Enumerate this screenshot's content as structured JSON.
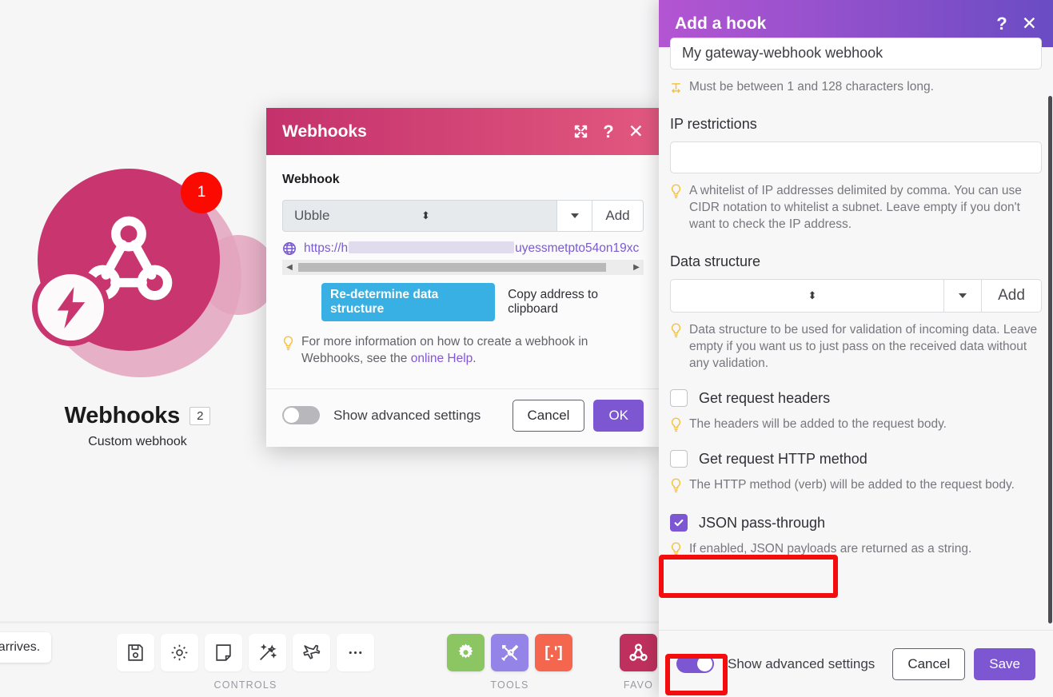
{
  "node": {
    "title": "Webhooks",
    "count_badge": "2",
    "error_badge": "1",
    "subtitle": "Custom webhook"
  },
  "tooltip": {
    "text": "ta arrives."
  },
  "toolbar": {
    "groups": [
      {
        "label": "CONTROLS",
        "items": [
          {
            "name": "save-icon"
          },
          {
            "name": "gear-icon"
          },
          {
            "name": "note-icon"
          },
          {
            "name": "magic-wand-icon"
          },
          {
            "name": "airplane-icon"
          },
          {
            "name": "more-options-icon"
          }
        ]
      },
      {
        "label": "TOOLS",
        "items": [
          {
            "name": "tools-gear-icon",
            "color": "#8cc662"
          },
          {
            "name": "tools-wrench-icon",
            "color": "#9584e8"
          },
          {
            "name": "tools-regex-icon",
            "color": "#f4674e",
            "glyph": "[.']"
          }
        ]
      },
      {
        "label": "FAVO",
        "items": [
          {
            "name": "favorites-webhook-icon",
            "color": "#c0305f"
          }
        ]
      }
    ]
  },
  "webhooks_dialog": {
    "title": "Webhooks",
    "help_icon": "question-mark-icon",
    "close_icon": "close-icon",
    "expand_icon": "expand-icon",
    "section_label": "Webhook",
    "select_value": "Ubble",
    "add_label": "Add",
    "url_prefix": "https://h",
    "url_suffix": "uyessmetpto54on19xc",
    "redetermine_label": "Re-determine data structure",
    "copy_label": "Copy address to clipboard",
    "hint_text_1": "For more information on how to create a webhook in Webhooks, see the ",
    "hint_link": "online Help",
    "hint_text_2": ".",
    "advanced_label": "Show advanced settings",
    "cancel_label": "Cancel",
    "ok_label": "OK"
  },
  "hook_panel": {
    "title": "Add a hook",
    "help_icon": "question-mark-icon",
    "close_icon": "close-icon",
    "name_value": "My gateway-webhook webhook",
    "name_hint": "Must be between 1 and 128 characters long.",
    "ip_label": "IP restrictions",
    "ip_value": "",
    "ip_hint": "A whitelist of IP addresses delimited by comma. You can use CIDR notation to whitelist a subnet. Leave empty if you don't want to check the IP address.",
    "datastructure_label": "Data structure",
    "datastructure_value": "",
    "datastructure_add": "Add",
    "datastructure_hint": "Data structure to be used for validation of incoming data. Leave empty if you want us to just pass on the received data without any validation.",
    "checkboxes": [
      {
        "label": "Get request headers",
        "checked": false,
        "hint": "The headers will be added to the request body."
      },
      {
        "label": "Get request HTTP method",
        "checked": false,
        "hint": "The HTTP method (verb) will be added to the request body."
      },
      {
        "label": "JSON pass-through",
        "checked": true,
        "hint": "If enabled, JSON payloads are returned as a string."
      }
    ],
    "advanced_label": "Show advanced settings",
    "advanced_on": true,
    "cancel_label": "Cancel",
    "save_label": "Save"
  },
  "colors": {
    "accent_purple": "#7d56d1",
    "accent_pink": "#c9366f",
    "annotation_red": "#f40d0d",
    "badge_red": "#fb0a02",
    "pill_blue": "#38b0e3",
    "hint_yellow": "#f5c343"
  }
}
